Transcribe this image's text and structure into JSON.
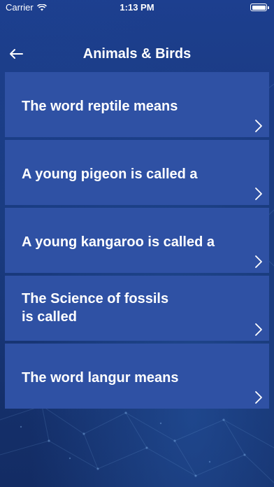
{
  "status_bar": {
    "carrier": "Carrier",
    "time": "1:13 PM"
  },
  "nav": {
    "title": "Animals & Birds",
    "back_icon": "arrow-left-icon"
  },
  "questions": [
    {
      "text": "The word reptile means"
    },
    {
      "text": "A young pigeon is called a"
    },
    {
      "text": "A young kangaroo is called a"
    },
    {
      "text": "The Science of fossils\nis called"
    },
    {
      "text": "The word langur means"
    }
  ],
  "colors": {
    "background": "#183777",
    "card": "#2f51a4",
    "text": "#ffffff"
  }
}
